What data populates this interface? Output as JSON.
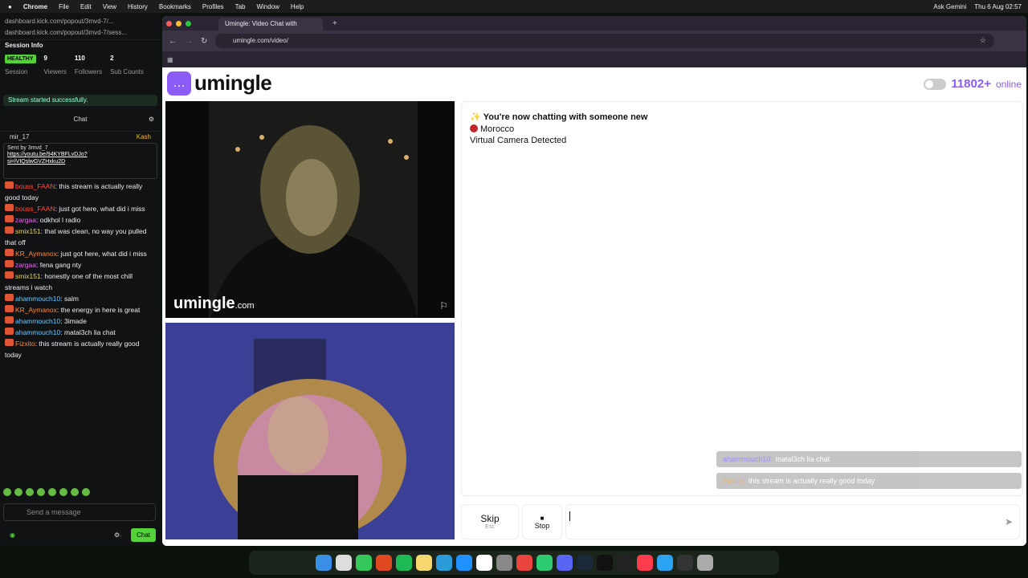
{
  "menubar": {
    "items": [
      "Chrome",
      "File",
      "Edit",
      "View",
      "History",
      "Bookmarks",
      "Profiles",
      "Tab",
      "Window",
      "Help"
    ],
    "ask": "Ask Gemini",
    "clock": "Thu 6 Aug  02:57"
  },
  "kick": {
    "url1": "dashboard.kick.com/popout/3mvd-7/...",
    "url2": "dashboard.kick.com/popout/3mvd-7/sess...",
    "session_title": "Session Info",
    "health": "HEALTHY",
    "health_label": "Session",
    "stats": [
      {
        "value": "9",
        "label": "Viewers"
      },
      {
        "value": "110",
        "label": "Followers"
      },
      {
        "value": "2",
        "label": "Sub Counts"
      }
    ],
    "toast": "Stream started successfully.",
    "chat_title": "Chat",
    "pin_user": "mir_17",
    "pin_kash": "Kash",
    "pinned_sent": "Sent by",
    "pinned_user": "3mvd_7",
    "pinned_link1": "https://youtu.be/94KYBFLvDJo?",
    "pinned_link2": "si=lVIQslwGVZHxku2D",
    "messages": [
      {
        "user": "bouss_FAAN",
        "text": "this stream is actually really good today",
        "color": "#ff4d3d"
      },
      {
        "user": "bouss_FAAN",
        "text": "just got here, what did i miss",
        "color": "#ff4d3d"
      },
      {
        "user": "zargaa",
        "text": "odkhol l radio",
        "color": "#e86ae8"
      },
      {
        "user": "smix151",
        "text": "that was clean, no way you pulled that off",
        "color": "#e8d46a"
      },
      {
        "user": "KR_Aymanox",
        "text": "just got here, what did i miss",
        "color": "#ff8a3d"
      },
      {
        "user": "zargaa",
        "text": "fena gang nty",
        "color": "#e86ae8"
      },
      {
        "user": "smix151",
        "text": "honestly one of the most chill streams i watch",
        "color": "#e8d46a"
      },
      {
        "user": "ahammouch10",
        "text": "salm",
        "color": "#6ac8ff"
      },
      {
        "user": "KR_Aymanox",
        "text": "the energy in here is great",
        "color": "#ff8a3d"
      },
      {
        "user": "ahammouch10",
        "text": "3imade",
        "color": "#6ac8ff"
      },
      {
        "user": "ahammouch10",
        "text": "matal3ch lia chat",
        "color": "#6ac8ff"
      },
      {
        "user": "Fizxito",
        "text": "this stream is actually really good today",
        "color": "#ff8a3d"
      }
    ],
    "input_placeholder": "Send a message",
    "chat_button": "Chat"
  },
  "browser": {
    "tab_title": "Umingle: Video Chat with",
    "url": "umingle.com/video/"
  },
  "umingle": {
    "logo": "umingle",
    "online_count": "11802+",
    "online_label": "online",
    "watermark": "umingle",
    "watermark_tld": ".com",
    "chat_lines": [
      "You're now chatting with someone new",
      "Morocco",
      "Virtual Camera Detected"
    ],
    "overlay": [
      {
        "user": "ahammouch10",
        "text": "matal3ch lia chat"
      },
      {
        "user": "Fizxito",
        "text": "this stream is actually really good today"
      }
    ],
    "skip_label": "Skip",
    "skip_key": "Esc",
    "stop_label": "Stop"
  }
}
